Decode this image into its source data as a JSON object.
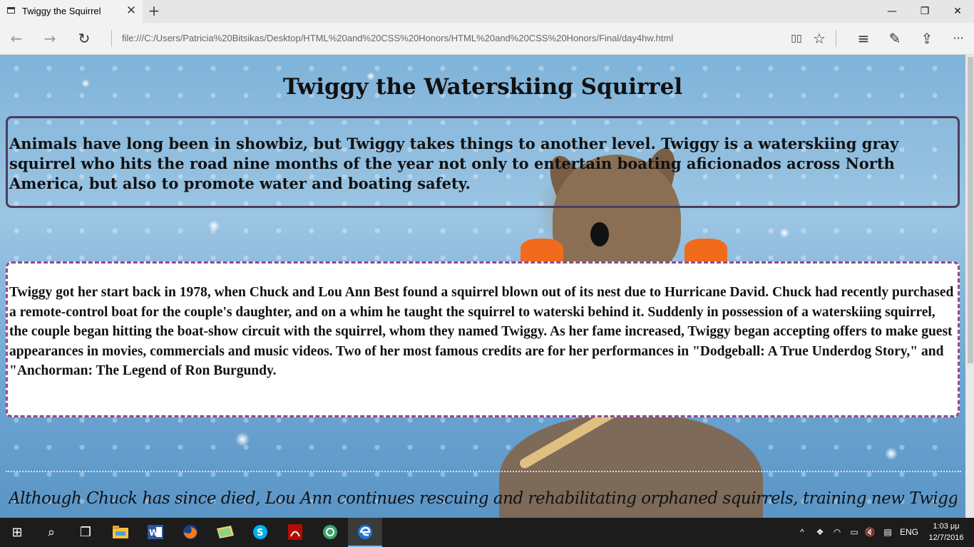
{
  "browser": {
    "tab_title": "Twiggy the Squirrel",
    "close_tab_glyph": "✕",
    "new_tab_glyph": "+",
    "window_controls": {
      "minimize": "—",
      "restore": "❐",
      "close": "✕"
    },
    "nav": {
      "back": "←",
      "forward": "→",
      "refresh": "↻"
    },
    "address": "file:///C:/Users/Patricia%20Bitsikas/Desktop/HTML%20and%20CSS%20Honors/HTML%20and%20CSS%20Honors/Final/day4hw.html",
    "toolbar_icons": {
      "reading_view": "▯▯",
      "favorite": "☆",
      "hub": "≡",
      "web_note": "✎",
      "share": "⇪",
      "more": "···"
    }
  },
  "page": {
    "heading": "Twiggy the Waterskiing Squirrel",
    "paragraph1": "Animals have long been in showbiz, but Twiggy takes things to another level. Twiggy is a waterskiing gray squirrel who hits the road nine months of the year not only to entertain boating aficionados across North America, but also to promote water and boating safety.",
    "paragraph2": "Twiggy got her start back in 1978, when Chuck and Lou Ann Best found a squirrel blown out of its nest due to Hurricane David. Chuck had recently purchased a remote-control boat for the couple's daughter, and on a whim he taught the squirrel to waterski behind it. Suddenly in possession of a waterskiing squirrel, the couple began hitting the boat-show circuit with the squirrel, whom they named Twiggy. As her fame increased, Twiggy began accepting offers to make guest appearances in movies, commercials and music videos. Two of her most famous credits are for her performances in \"Dodgeball: A True Underdog Story,\" and \"Anchorman: The Legend of Ron Burgundy.",
    "paragraph3": "Although Chuck has since died, Lou Ann continues rescuing and rehabilitating orphaned squirrels, training new Twiggys as"
  },
  "taskbar": {
    "start": "⊞",
    "search": "⌕",
    "task_view": "❐",
    "apps": [
      "file-explorer-icon",
      "word-icon",
      "firefox-icon",
      "folder-icon",
      "skype-icon",
      "acrobat-icon",
      "network-app-icon",
      "edge-icon"
    ],
    "tray": {
      "chevron": "^",
      "language": "ENG",
      "time": "1:03 μμ",
      "date": "12/7/2016"
    }
  },
  "colors": {
    "box1_border": "#4a3e5c",
    "box2_border": "#8b4f8e",
    "edge_accent": "#76b9ed"
  }
}
